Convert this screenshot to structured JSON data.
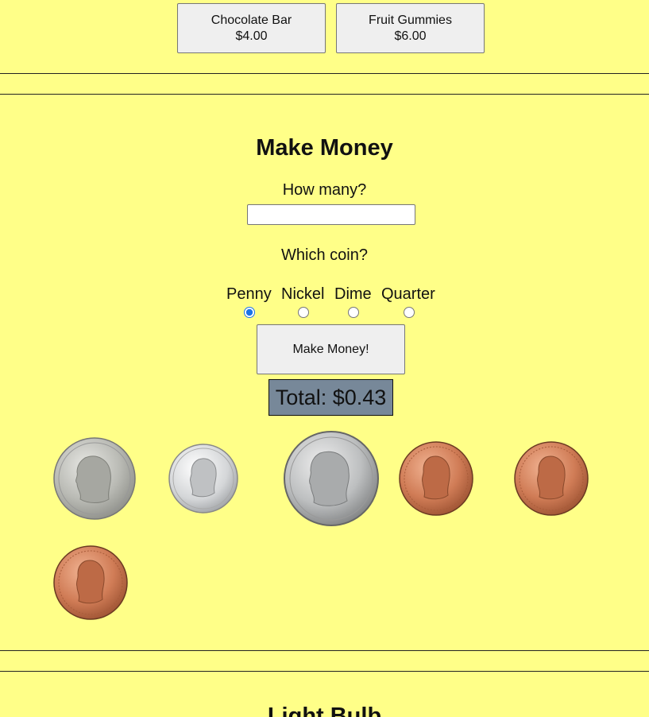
{
  "snacks": [
    {
      "name": "Chocolate Bar",
      "price": "$4.00"
    },
    {
      "name": "Fruit Gummies",
      "price": "$6.00"
    }
  ],
  "make_money": {
    "title": "Make Money",
    "how_many_label": "How many?",
    "how_many_value": "",
    "which_coin_label": "Which coin?",
    "coin_options": [
      "Penny",
      "Nickel",
      "Dime",
      "Quarter"
    ],
    "selected_coin": "Penny",
    "button_label": "Make Money!",
    "total_text": "Total: $0.43"
  },
  "coins_displayed": [
    "nickel",
    "dime",
    "quarter",
    "penny",
    "penny",
    "penny"
  ],
  "next_section": {
    "title": "Light Bulb"
  },
  "colors": {
    "background": "#ffff88",
    "total_box": "#778899",
    "penny": "#c8734f",
    "silver": "#c9c9c9"
  }
}
